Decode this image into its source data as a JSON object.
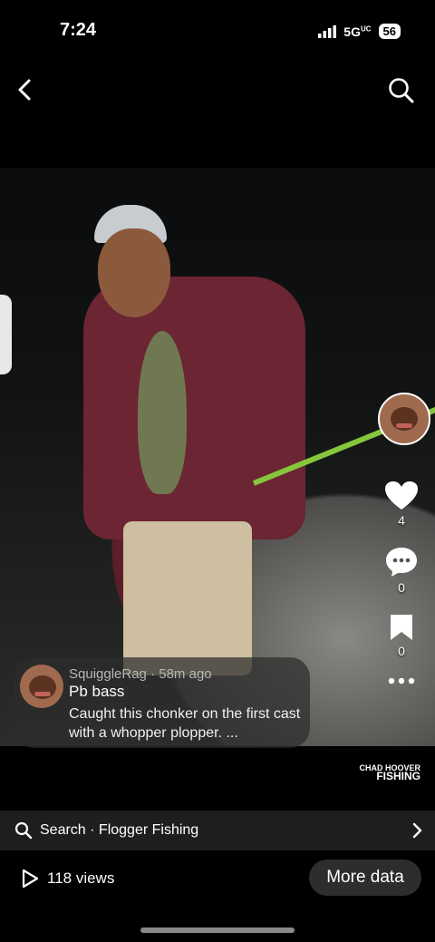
{
  "status_bar": {
    "time": "7:24",
    "network": "5G",
    "network_super": "UC",
    "battery": "56"
  },
  "nav": {
    "back_icon": "chevron-left-icon",
    "search_icon": "search-icon"
  },
  "actions": {
    "likes": "4",
    "comments": "0",
    "saves": "0"
  },
  "caption": {
    "username": "SquiggleRag",
    "time_ago": "58m ago",
    "title": "Pb bass",
    "text": "Caught this chonker on the first cast with a whopper plopper. ..."
  },
  "watermark": {
    "line1": "CHAD HOOVER",
    "line2": "FISHING"
  },
  "search_bar": {
    "label": "Search · Flogger Fishing"
  },
  "footer": {
    "views": "118 views",
    "more_data_label": "More data"
  }
}
